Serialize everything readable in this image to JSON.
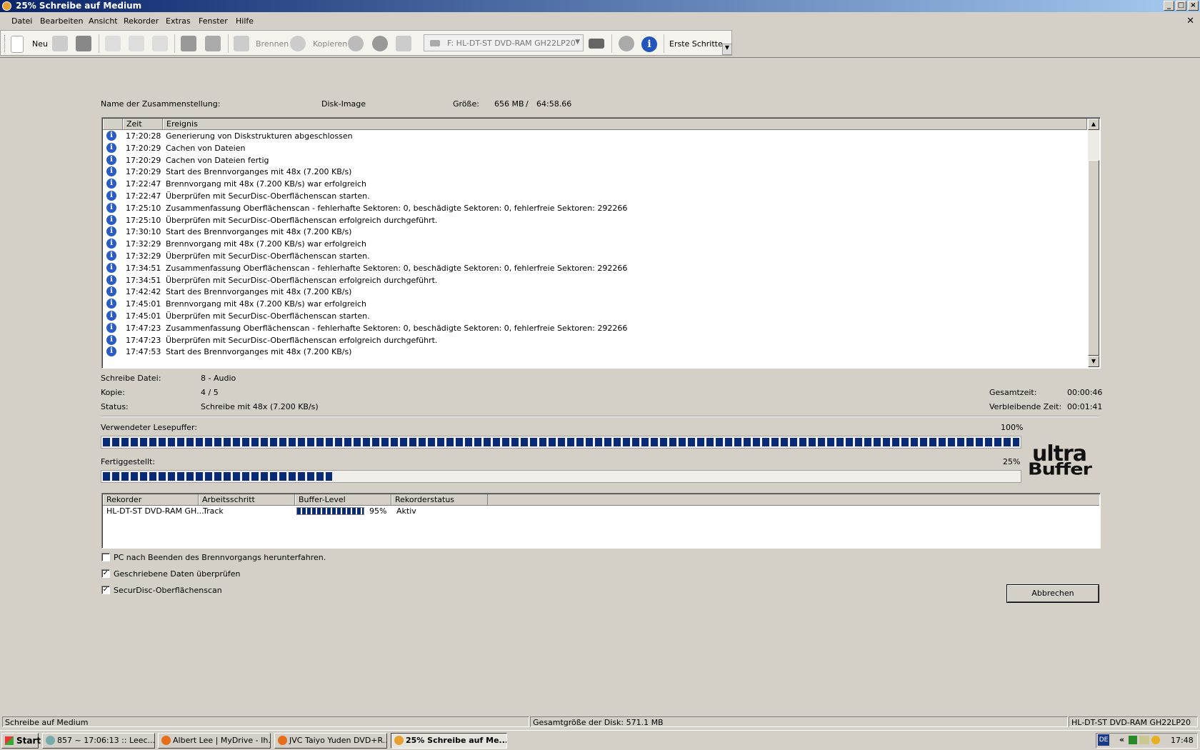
{
  "window": {
    "title": "25% Schreibe auf Medium"
  },
  "menu": [
    "Datei",
    "Bearbeiten",
    "Ansicht",
    "Rekorder",
    "Extras",
    "Fenster",
    "Hilfe"
  ],
  "toolbar": {
    "new_label": "Neu",
    "burn_label": "Brennen",
    "copy_label": "Kopieren",
    "drive": "F: HL-DT-ST DVD-RAM GH22LP20",
    "first_steps": "Erste Schritte"
  },
  "compilation": {
    "name_label": "Name der Zusammenstellung:",
    "name_value": "Disk-Image",
    "size_label": "Größe:",
    "size_mb": "656 MB",
    "size_sep": "/",
    "size_time": "64:58.66"
  },
  "log": {
    "col_time": "Zeit",
    "col_event": "Ereignis",
    "rows": [
      {
        "time": "17:20:28",
        "event": "Generierung von Diskstrukturen abgeschlossen"
      },
      {
        "time": "17:20:29",
        "event": "Cachen von Dateien"
      },
      {
        "time": "17:20:29",
        "event": "Cachen von Dateien fertig"
      },
      {
        "time": "17:20:29",
        "event": "Start des Brennvorganges mit 48x (7.200 KB/s)"
      },
      {
        "time": "17:22:47",
        "event": "Brennvorgang mit 48x (7.200 KB/s) war erfolgreich"
      },
      {
        "time": "17:22:47",
        "event": "Überprüfen mit SecurDisc-Oberflächenscan starten."
      },
      {
        "time": "17:25:10",
        "event": "Zusammenfassung Oberflächenscan - fehlerhafte Sektoren: 0, beschädigte Sektoren: 0, fehlerfreie Sektoren: 292266"
      },
      {
        "time": "17:25:10",
        "event": "Überprüfen mit SecurDisc-Oberflächenscan erfolgreich durchgeführt."
      },
      {
        "time": "17:30:10",
        "event": "Start des Brennvorganges mit 48x (7.200 KB/s)"
      },
      {
        "time": "17:32:29",
        "event": "Brennvorgang mit 48x (7.200 KB/s) war erfolgreich"
      },
      {
        "time": "17:32:29",
        "event": "Überprüfen mit SecurDisc-Oberflächenscan starten."
      },
      {
        "time": "17:34:51",
        "event": "Zusammenfassung Oberflächenscan - fehlerhafte Sektoren: 0, beschädigte Sektoren: 0, fehlerfreie Sektoren: 292266"
      },
      {
        "time": "17:34:51",
        "event": "Überprüfen mit SecurDisc-Oberflächenscan erfolgreich durchgeführt."
      },
      {
        "time": "17:42:42",
        "event": "Start des Brennvorganges mit 48x (7.200 KB/s)"
      },
      {
        "time": "17:45:01",
        "event": "Brennvorgang mit 48x (7.200 KB/s) war erfolgreich"
      },
      {
        "time": "17:45:01",
        "event": "Überprüfen mit SecurDisc-Oberflächenscan starten."
      },
      {
        "time": "17:47:23",
        "event": "Zusammenfassung Oberflächenscan - fehlerhafte Sektoren: 0, beschädigte Sektoren: 0, fehlerfreie Sektoren: 292266"
      },
      {
        "time": "17:47:23",
        "event": "Überprüfen mit SecurDisc-Oberflächenscan erfolgreich durchgeführt."
      },
      {
        "time": "17:47:53",
        "event": "Start des Brennvorganges mit 48x (7.200 KB/s)"
      }
    ]
  },
  "progress": {
    "write_file_label": "Schreibe Datei:",
    "write_file_value": "8 - Audio",
    "copy_label": "Kopie:",
    "copy_value": "4 / 5",
    "status_label": "Status:",
    "status_value": "Schreibe mit 48x (7.200 KB/s)",
    "total_time_label": "Gesamtzeit:",
    "total_time_value": "00:00:46",
    "remaining_label": "Verbleibende Zeit:",
    "remaining_value": "00:01:41",
    "buffer_label": "Verwendeter Lesepuffer:",
    "buffer_percent": "100%",
    "buffer_fraction": 1.0,
    "done_label": "Fertiggestellt:",
    "done_percent": "25%",
    "done_fraction": 0.25,
    "logo_line1": "ultra",
    "logo_line2": "Buffer"
  },
  "recorders": {
    "col_recorder": "Rekorder",
    "col_step": "Arbeitsschritt",
    "col_buffer": "Buffer-Level",
    "col_status": "Rekorderstatus",
    "row": {
      "recorder": "HL-DT-ST DVD-RAM GH...",
      "step": "Track",
      "buffer": "95%",
      "buffer_fraction": 0.95,
      "status": "Aktiv"
    }
  },
  "options": [
    {
      "label": "PC nach Beenden des Brennvorgangs herunterfahren.",
      "checked": false
    },
    {
      "label": "Geschriebene Daten überprüfen",
      "checked": true
    },
    {
      "label": "SecurDisc-Oberflächenscan",
      "checked": true
    }
  ],
  "abort_label": "Abbrechen",
  "statusbar": {
    "left": "Schreibe auf Medium",
    "middle": "Gesamtgröße der Disk: 571.1 MB",
    "right": "HL-DT-ST DVD-RAM GH22LP20"
  },
  "taskbar": {
    "start": "Start",
    "tasks": [
      "857 ~ 17:06:13 :: Leec...",
      "Albert Lee | MyDrive - Ih...",
      "JVC Taiyo Yuden DVD+R...",
      "25% Schreibe auf Me..."
    ],
    "lang": "DE",
    "clock": "17:48",
    "chevron": "«"
  }
}
